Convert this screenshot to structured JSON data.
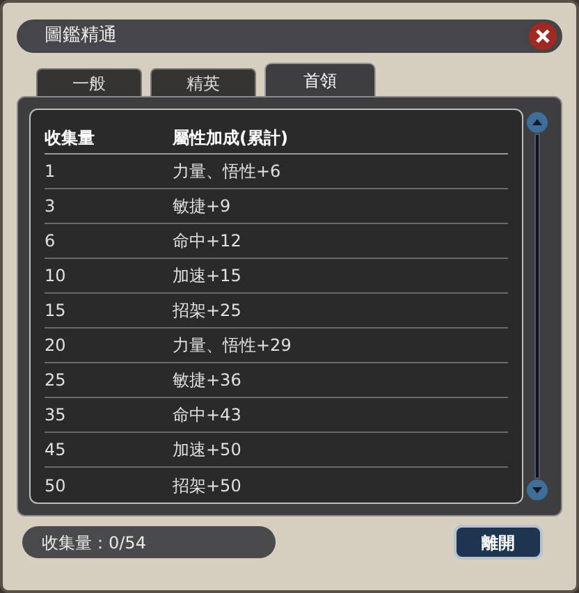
{
  "window": {
    "title": "圖鑑精通"
  },
  "tabs": [
    {
      "label": "一般",
      "selected": false
    },
    {
      "label": "精英",
      "selected": false
    },
    {
      "label": "首領",
      "selected": true
    }
  ],
  "table": {
    "columns": [
      "收集量",
      "屬性加成(累計)"
    ],
    "rows": [
      [
        "1",
        "力量、悟性+6"
      ],
      [
        "3",
        "敏捷+9"
      ],
      [
        "6",
        "命中+12"
      ],
      [
        "10",
        "加速+15"
      ],
      [
        "15",
        "招架+25"
      ],
      [
        "20",
        "力量、悟性+29"
      ],
      [
        "25",
        "敏捷+36"
      ],
      [
        "35",
        "命中+43"
      ],
      [
        "45",
        "加速+50"
      ],
      [
        "50",
        "招架+50"
      ]
    ]
  },
  "footer": {
    "collection": "收集量：0/54",
    "button": "離開"
  }
}
